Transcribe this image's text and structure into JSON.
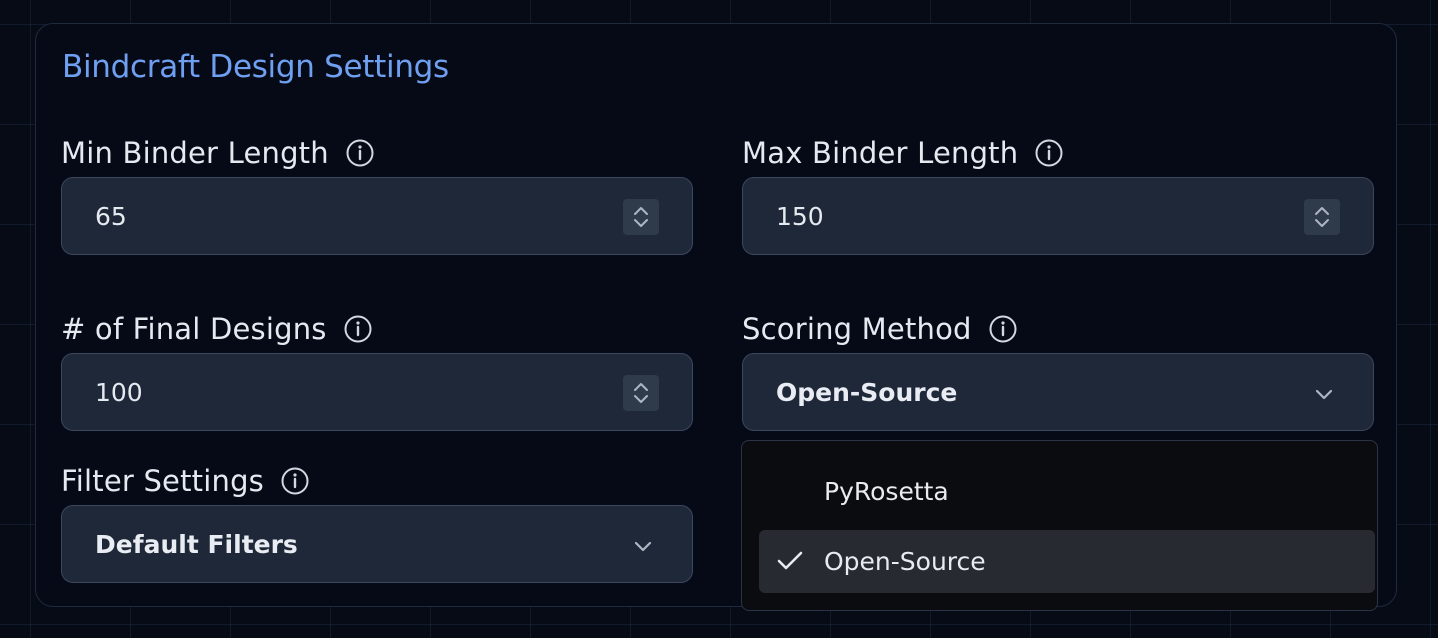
{
  "panel": {
    "title": "Bindcraft Design Settings"
  },
  "fields": {
    "min_binder_length": {
      "label": "Min Binder Length",
      "value": "65"
    },
    "max_binder_length": {
      "label": "Max Binder Length",
      "value": "150"
    },
    "final_designs": {
      "label": "# of Final Designs",
      "value": "100"
    },
    "scoring_method": {
      "label": "Scoring Method",
      "value": "Open-Source"
    },
    "filter_settings": {
      "label": "Filter Settings",
      "value": "Default Filters"
    }
  },
  "scoring_dropdown": {
    "options": [
      {
        "label": "PyRosetta",
        "selected": false
      },
      {
        "label": "Open-Source",
        "selected": true
      }
    ]
  },
  "icons": {
    "info": "info-circle-icon",
    "stepper": "up-down-chevron-icon",
    "select": "chevron-down-icon",
    "check": "check-icon"
  },
  "colors": {
    "title": "#6f9ff0",
    "background": "#070b16",
    "input_bg": "#1f2838",
    "input_border": "#3a475c",
    "dropdown_bg": "#0b0c0f",
    "selected_option_bg": "#272a30"
  }
}
